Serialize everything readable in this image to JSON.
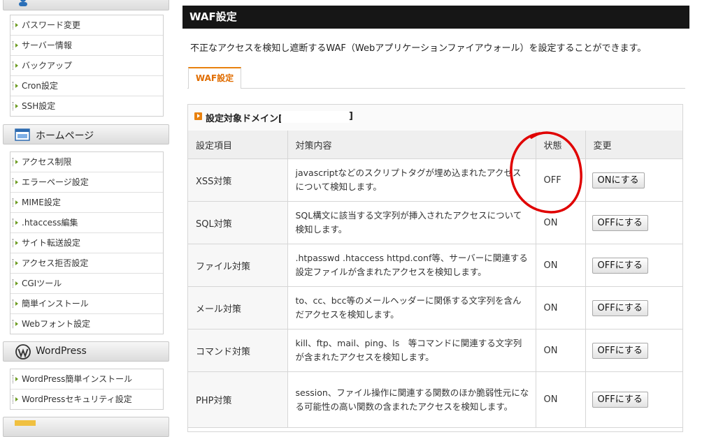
{
  "sidebar": {
    "account_menu": [
      {
        "label": "パスワード変更"
      },
      {
        "label": "サーバー情報"
      },
      {
        "label": "バックアップ"
      },
      {
        "label": "Cron設定"
      },
      {
        "label": "SSH設定"
      }
    ],
    "homepage_title": "ホームページ",
    "homepage_menu": [
      {
        "label": "アクセス制限"
      },
      {
        "label": "エラーページ設定"
      },
      {
        "label": "MIME設定"
      },
      {
        "label": ".htaccess編集"
      },
      {
        "label": "サイト転送設定"
      },
      {
        "label": "アクセス拒否設定"
      },
      {
        "label": "CGIツール"
      },
      {
        "label": "簡単インストール"
      },
      {
        "label": "Webフォント設定"
      }
    ],
    "wordpress_title": "WordPress",
    "wordpress_menu": [
      {
        "label": "WordPress簡単インストール"
      },
      {
        "label": "WordPressセキュリティ設定"
      }
    ]
  },
  "main": {
    "title": "WAF設定",
    "description": "不正なアクセスを検知し遮断するWAF（Webアプリケーションファイアウォール）を設定することができます。",
    "tab_label": "WAF設定",
    "domain_label": "設定対象ドメイン[",
    "domain_close": "]",
    "table": {
      "headers": {
        "item": "設定項目",
        "content": "対策内容",
        "state": "状態",
        "change": "変更"
      },
      "rows": [
        {
          "item": "XSS対策",
          "content": "javascriptなどのスクリプトタグが埋め込まれたアクセスについて検知します。",
          "state": "OFF",
          "button": "ONにする"
        },
        {
          "item": "SQL対策",
          "content": "SQL構文に該当する文字列が挿入されたアクセスについて検知します。",
          "state": "ON",
          "button": "OFFにする"
        },
        {
          "item": "ファイル対策",
          "content": ".htpasswd .htaccess httpd.conf等、サーバーに関連する設定ファイルが含まれたアクセスを検知します。",
          "state": "ON",
          "button": "OFFにする"
        },
        {
          "item": "メール対策",
          "content": "to、cc、bcc等のメールヘッダーに関係する文字列を含んだアクセスを検知します。",
          "state": "ON",
          "button": "OFFにする"
        },
        {
          "item": "コマンド対策",
          "content": "kill、ftp、mail、ping、ls　等コマンドに関連する文字列が含まれたアクセスを検知します。",
          "state": "ON",
          "button": "OFFにする"
        },
        {
          "item": "PHP対策",
          "content": "session、ファイル操作に関連する関数のほか脆弱性元になる可能性の高い関数の含まれたアクセスを検知します。",
          "state": "ON",
          "button": "OFFにする"
        }
      ]
    }
  },
  "colors": {
    "header_bg": "#161616",
    "accent": "#e8810e",
    "annotation": "#e00000"
  }
}
